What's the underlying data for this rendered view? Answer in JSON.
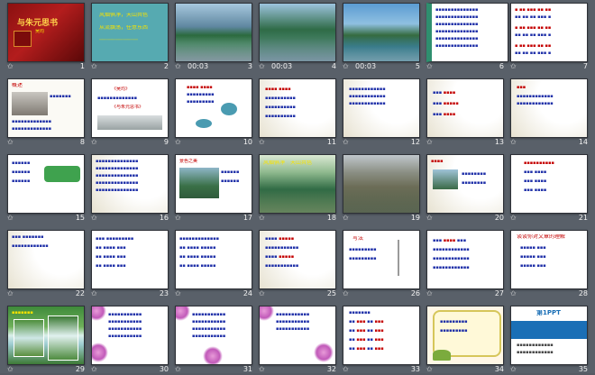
{
  "slides": [
    {
      "num": "1",
      "time": "",
      "title": "与朱元思书",
      "author": "吴均"
    },
    {
      "num": "2",
      "time": "",
      "line1": "风烟俱净，天山共色",
      "line2": "从流飘荡，任意东西"
    },
    {
      "num": "3",
      "time": "00:03"
    },
    {
      "num": "4",
      "time": "00:03"
    },
    {
      "num": "5",
      "time": "00:03"
    },
    {
      "num": "6",
      "time": ""
    },
    {
      "num": "7",
      "time": ""
    },
    {
      "num": "8",
      "time": "",
      "heading": "概述"
    },
    {
      "num": "9",
      "time": "",
      "line1": "《吴均》",
      "line2": "《与朱元思书》"
    },
    {
      "num": "10",
      "time": ""
    },
    {
      "num": "11",
      "time": ""
    },
    {
      "num": "12",
      "time": ""
    },
    {
      "num": "13",
      "time": ""
    },
    {
      "num": "14",
      "time": ""
    },
    {
      "num": "15",
      "time": ""
    },
    {
      "num": "16",
      "time": ""
    },
    {
      "num": "17",
      "time": "",
      "heading": "景色之美"
    },
    {
      "num": "18",
      "time": "",
      "heading": "风烟俱净　天山共色"
    },
    {
      "num": "19",
      "time": ""
    },
    {
      "num": "20",
      "time": ""
    },
    {
      "num": "21",
      "time": ""
    },
    {
      "num": "22",
      "time": ""
    },
    {
      "num": "23",
      "time": ""
    },
    {
      "num": "24",
      "time": ""
    },
    {
      "num": "25",
      "time": ""
    },
    {
      "num": "26",
      "time": "",
      "heading": "写法"
    },
    {
      "num": "27",
      "time": ""
    },
    {
      "num": "28",
      "time": "",
      "heading": "谈谈你对文章的理解"
    },
    {
      "num": "29",
      "time": ""
    },
    {
      "num": "30",
      "time": ""
    },
    {
      "num": "31",
      "time": ""
    },
    {
      "num": "32",
      "time": ""
    },
    {
      "num": "33",
      "time": ""
    },
    {
      "num": "34",
      "time": ""
    },
    {
      "num": "35",
      "time": "",
      "brand": "第1PPT"
    }
  ],
  "colors": {
    "background": "#596069",
    "text_blue": "#1e2fa8",
    "text_red": "#c40000",
    "title_gold": "#ffd24a"
  },
  "icons": {
    "star": "transition-star-icon"
  }
}
